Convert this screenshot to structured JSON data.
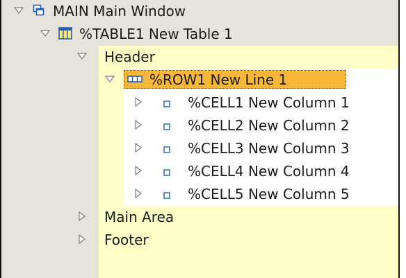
{
  "tree": {
    "main_window": {
      "label": "MAIN Main Window"
    },
    "table": {
      "label": "%TABLE1 New Table 1"
    },
    "header": {
      "label": "Header"
    },
    "row": {
      "label": "%ROW1 New Line 1"
    },
    "cells": [
      {
        "label": "%CELL1 New Column 1"
      },
      {
        "label": "%CELL2 New Column 2"
      },
      {
        "label": "%CELL3 New Column 3"
      },
      {
        "label": "%CELL4 New Column 4"
      },
      {
        "label": "%CELL5 New Column 5"
      }
    ],
    "main_area": {
      "label": "Main Area"
    },
    "footer": {
      "label": "Footer"
    }
  },
  "colors": {
    "node_bg_gray": "#e6e3da",
    "node_bg_yellow": "#ffffc8",
    "selection_bg": "#f7b83a",
    "icon_blue": "#1f5fbf"
  },
  "icons": {
    "expanded": "triangle-down-icon",
    "collapsed": "triangle-right-icon",
    "window": "window-icon",
    "table": "table-icon",
    "row": "row-icon",
    "cell": "cell-icon"
  }
}
